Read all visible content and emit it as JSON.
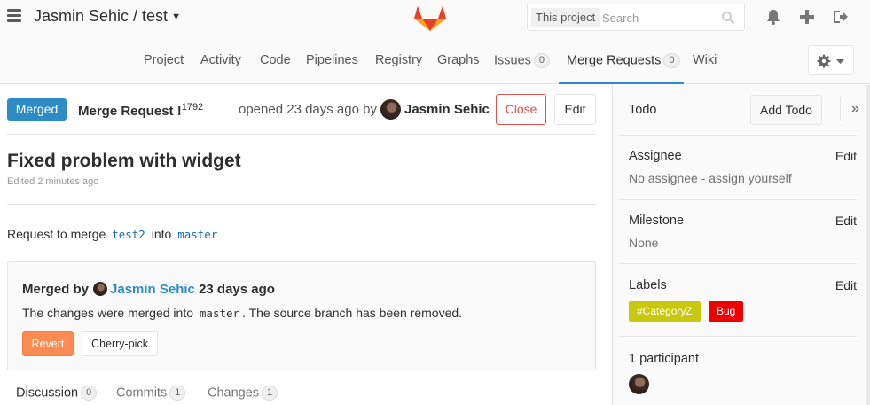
{
  "header": {
    "breadcrumb": "Jasmin Sehic / test",
    "search_scope": "This project",
    "search_placeholder": "Search",
    "icons": [
      "hamburger-icon",
      "gitlab-logo",
      "search-icon",
      "bell-icon",
      "plus-icon",
      "sign-out-icon"
    ]
  },
  "nav": {
    "tabs": [
      {
        "label": "Project"
      },
      {
        "label": "Activity"
      },
      {
        "label": "Code"
      },
      {
        "label": "Pipelines"
      },
      {
        "label": "Registry"
      },
      {
        "label": "Graphs"
      },
      {
        "label": "Issues",
        "count": "0"
      },
      {
        "label": "Merge Requests",
        "count": "0",
        "active": true
      },
      {
        "label": "Wiki"
      }
    ]
  },
  "mr": {
    "status": "Merged",
    "ref_label": "Merge Request !",
    "ref_number": "1792",
    "opened_text": "opened 23 days ago by",
    "author": "Jasmin Sehic",
    "close_label": "Close",
    "edit_label": "Edit",
    "title": "Fixed problem with widget",
    "edited_text": "Edited 2 minutes ago",
    "request_prefix": "Request to merge",
    "source_branch": "test2",
    "request_middle": "into",
    "target_branch": "master"
  },
  "merge_widget": {
    "merged_by_label": "Merged by",
    "user": "Jasmin Sehic",
    "time": "23 days ago",
    "text_before": "The changes were merged into",
    "branch": "master",
    "text_after": ". The source branch has been removed.",
    "revert_label": "Revert",
    "cherry_pick_label": "Cherry-pick"
  },
  "subtabs": [
    {
      "label": "Discussion",
      "count": "0",
      "active": true
    },
    {
      "label": "Commits",
      "count": "1"
    },
    {
      "label": "Changes",
      "count": "1"
    }
  ],
  "sidebar": {
    "todo_label": "Todo",
    "add_todo_label": "Add Todo",
    "collapse_glyph": "»",
    "assignee_label": "Assignee",
    "assignee_value": "No assignee - assign yourself",
    "milestone_label": "Milestone",
    "milestone_value": "None",
    "labels_label": "Labels",
    "edit_label": "Edit",
    "labels": [
      {
        "name": "#CategoryZ",
        "color": "#c8c80c"
      },
      {
        "name": "Bug",
        "color": "#ee0000"
      }
    ],
    "participants_label": "1 participant"
  },
  "colors": {
    "accent": "#2d8bc6",
    "close": "#d9534f",
    "revert": "#fc8a51"
  }
}
